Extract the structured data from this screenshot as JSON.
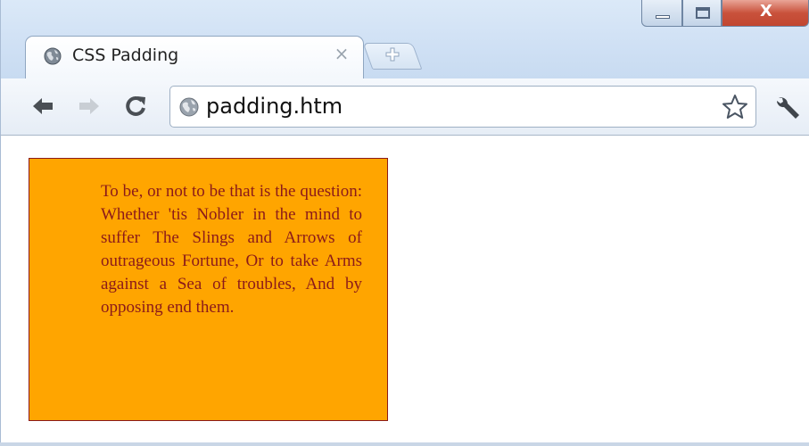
{
  "browser": {
    "tab": {
      "title": "CSS Padding",
      "close_glyph": "×"
    },
    "window_controls": {
      "close_glyph": "X"
    },
    "toolbar": {
      "back_icon": "arrow-left-icon",
      "forward_icon": "arrow-right-icon",
      "reload_icon": "reload-icon",
      "bookmark_icon": "star-icon",
      "settings_icon": "wrench-icon"
    },
    "address_bar": {
      "url": "padding.htm"
    }
  },
  "page": {
    "box": {
      "text": "To be, or not to be that is the question: Whether 'tis Nobler in the mind to suffer The Slings and Arrows of outrageous Fortune, Or to take Arms against a Sea of troubles, And by opposing end them.",
      "background_color": "#ffa500",
      "text_color": "#8b1a1a"
    }
  }
}
